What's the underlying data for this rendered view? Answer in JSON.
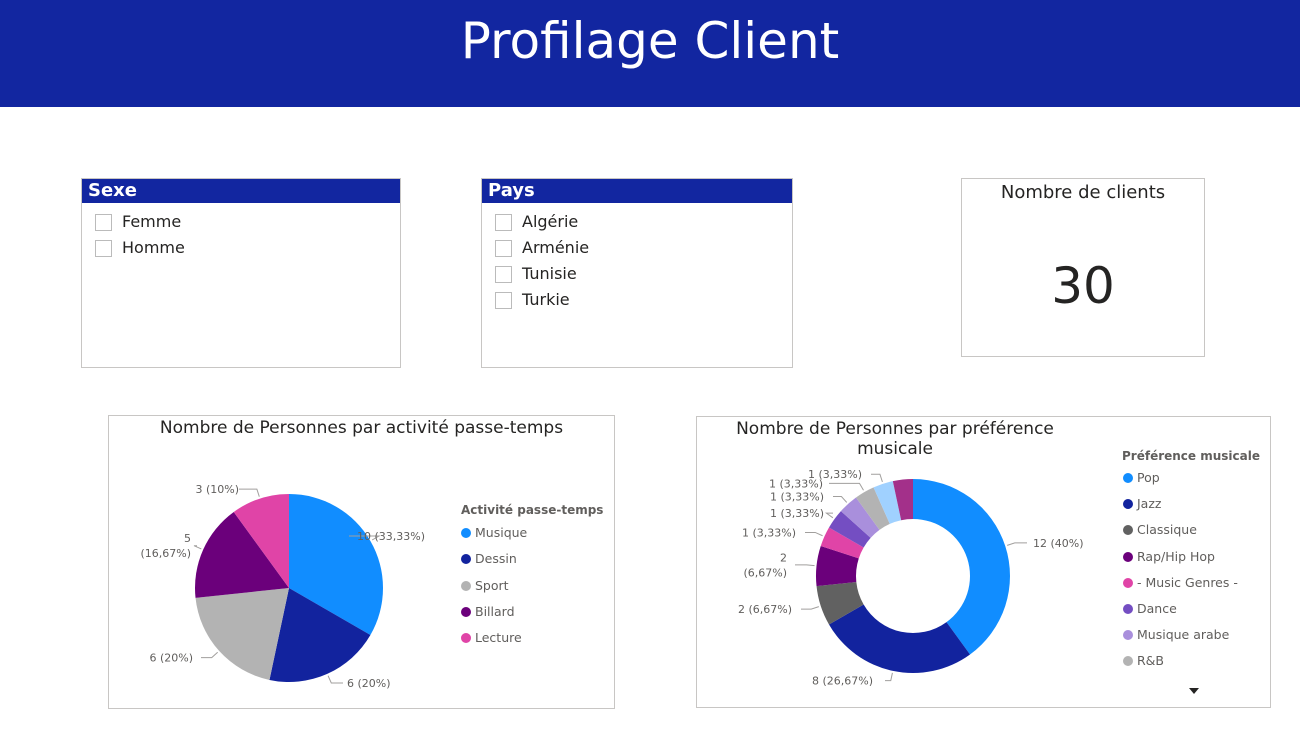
{
  "header": {
    "title": "Profilage Client"
  },
  "slicer_sexe": {
    "title": "Sexe",
    "items": [
      "Femme",
      "Homme"
    ]
  },
  "slicer_pays": {
    "title": "Pays",
    "items": [
      "Algérie",
      "Arménie",
      "Tunisie",
      "Turkie"
    ]
  },
  "card": {
    "title": "Nombre de clients",
    "value": "30"
  },
  "chart_data": [
    {
      "type": "pie",
      "title": "Nombre de Personnes par activité passe-temps",
      "legend_title": "Activité passe-temps",
      "legend_position": "right",
      "categories": [
        "Musique",
        "Dessin",
        "Sport",
        "Billard",
        "Lecture"
      ],
      "values": [
        10,
        6,
        6,
        5,
        3
      ],
      "colors": [
        "#118dff",
        "#12239e",
        "#b3b3b3",
        "#6b007b",
        "#e044a7"
      ],
      "data_labels": [
        "10 (33,33%)",
        "6 (20%)",
        "6 (20%)",
        "5 (16,67%)",
        "3 (10%)"
      ]
    },
    {
      "type": "pie",
      "subtype": "donut",
      "title": "Nombre de Personnes par préférence musicale",
      "legend_title": "Préférence musicale",
      "legend_position": "right",
      "categories": [
        "Pop",
        "Jazz",
        "Classique",
        "Rap/Hip Hop",
        "- Music Genres -",
        "Dance",
        "Musique arabe",
        "R&B"
      ],
      "values": [
        12,
        8,
        2,
        2,
        1,
        1,
        1,
        1,
        1,
        1
      ],
      "colors": [
        "#118dff",
        "#12239e",
        "#616161",
        "#6b007b",
        "#e044a7",
        "#744ec2",
        "#a98fdc",
        "#b3b3b3",
        "#a0d1ff",
        "#a3308a"
      ],
      "data_labels": [
        "12 (40%)",
        "8 (26,67%)",
        "2 (6,67%)",
        "2 (6,67%)",
        "1 (3,33%)",
        "1 (3,33%)",
        "1 (3,33%)",
        "1 (3,33%)",
        "1 (3,33%)"
      ]
    }
  ]
}
